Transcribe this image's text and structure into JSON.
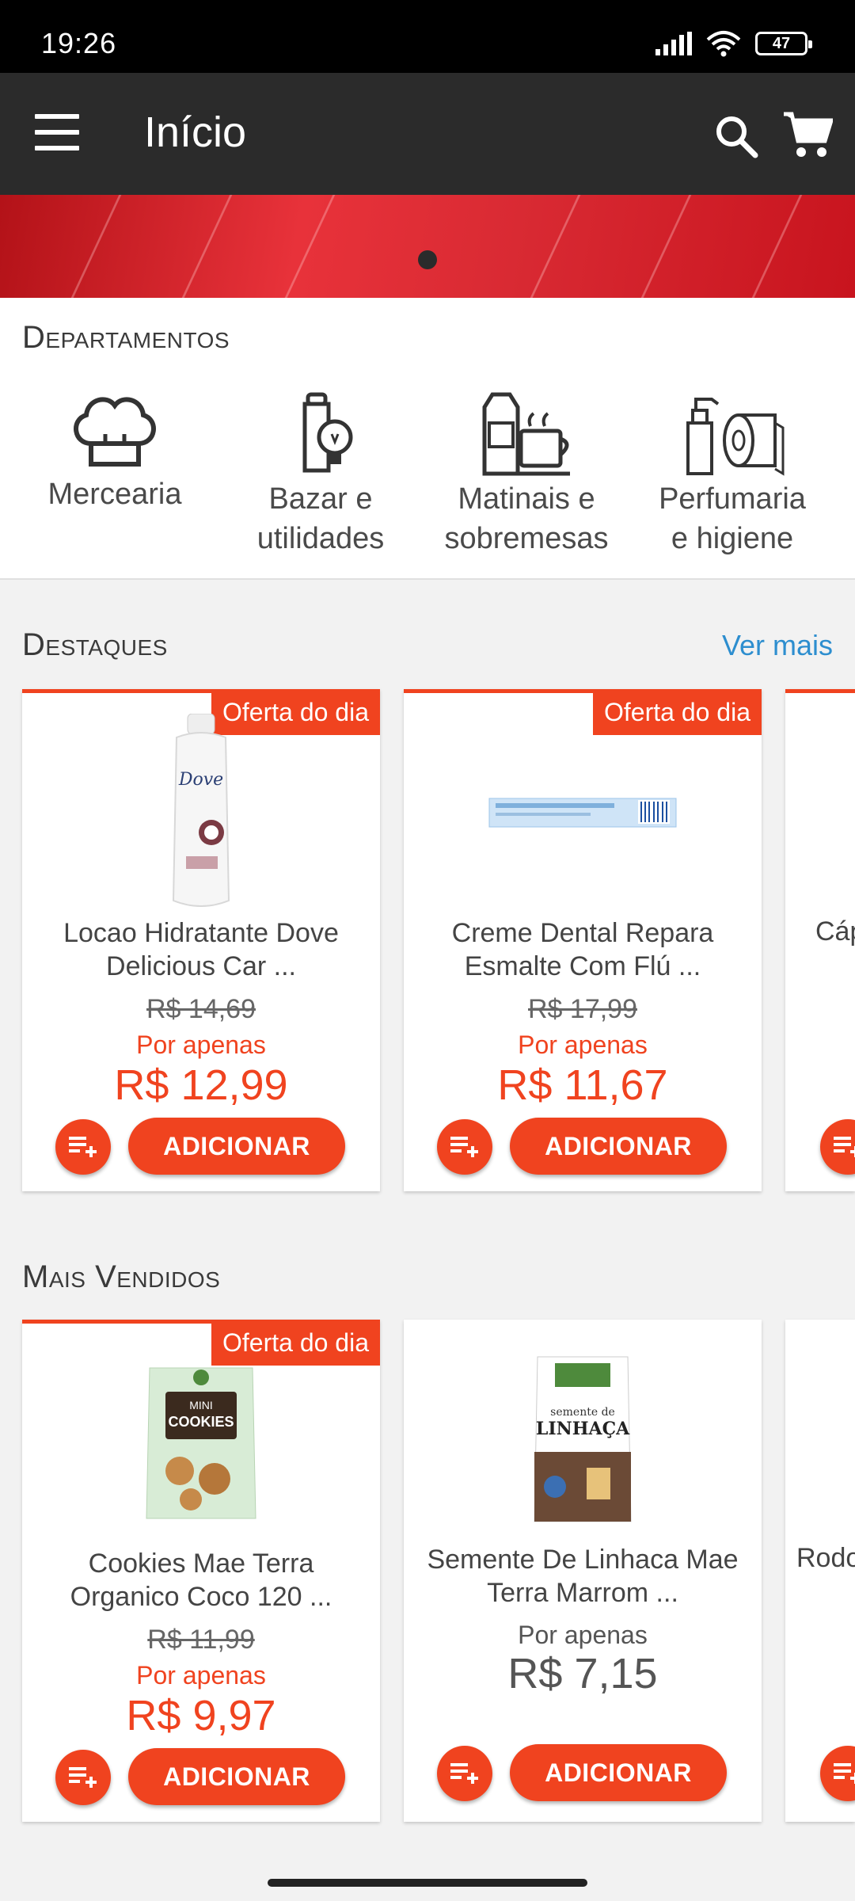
{
  "status_bar": {
    "time": "19:26",
    "battery": "47"
  },
  "app_bar": {
    "title": "Início"
  },
  "departments": {
    "title": "Departamentos",
    "items": [
      {
        "label_line1": "Mercearia",
        "label_line2": "",
        "icon": "chef-hat-icon"
      },
      {
        "label_line1": "Bazar e",
        "label_line2": "utilidades",
        "icon": "bulb-flask-icon"
      },
      {
        "label_line1": "Matinais e",
        "label_line2": "sobremesas",
        "icon": "breakfast-icon"
      },
      {
        "label_line1": "Perfumaria",
        "label_line2": "e higiene",
        "icon": "spray-toilet-paper-icon"
      }
    ]
  },
  "destaques": {
    "title": "Destaques",
    "see_more": "Ver mais",
    "products": [
      {
        "badge": "Oferta do dia",
        "name_line1": "Locao Hidratante Dove",
        "name_line2": "Delicious Car ...",
        "old_price": "R$ 14,69",
        "por_apenas": "Por apenas",
        "price": "R$ 12,99",
        "add_label": "ADICIONAR"
      },
      {
        "badge": "Oferta do dia",
        "name_line1": "Creme Dental Repara",
        "name_line2": "Esmalte Com Flú ...",
        "old_price": "R$ 17,99",
        "por_apenas": "Por apenas",
        "price": "R$ 11,67",
        "add_label": "ADICIONAR"
      }
    ],
    "partial_name": "Cáp"
  },
  "mais_vendidos": {
    "title": "Mais Vendidos",
    "products": [
      {
        "badge": "Oferta do dia",
        "name_line1": "Cookies Mae Terra",
        "name_line2": "Organico Coco 120 ...",
        "old_price": "R$ 11,99",
        "por_apenas": "Por apenas",
        "price": "R$ 9,97",
        "add_label": "ADICIONAR"
      },
      {
        "badge": "",
        "name_line1": "Semente De Linhaca Mae",
        "name_line2": "Terra Marrom ...",
        "old_price": "",
        "por_apenas": "Por apenas",
        "price": "R$ 7,15",
        "add_label": "ADICIONAR"
      }
    ],
    "partial_name": "Rodo"
  },
  "colors": {
    "accent": "#f0431f",
    "appbar": "#2b2b2b",
    "link": "#2d8ecf"
  }
}
